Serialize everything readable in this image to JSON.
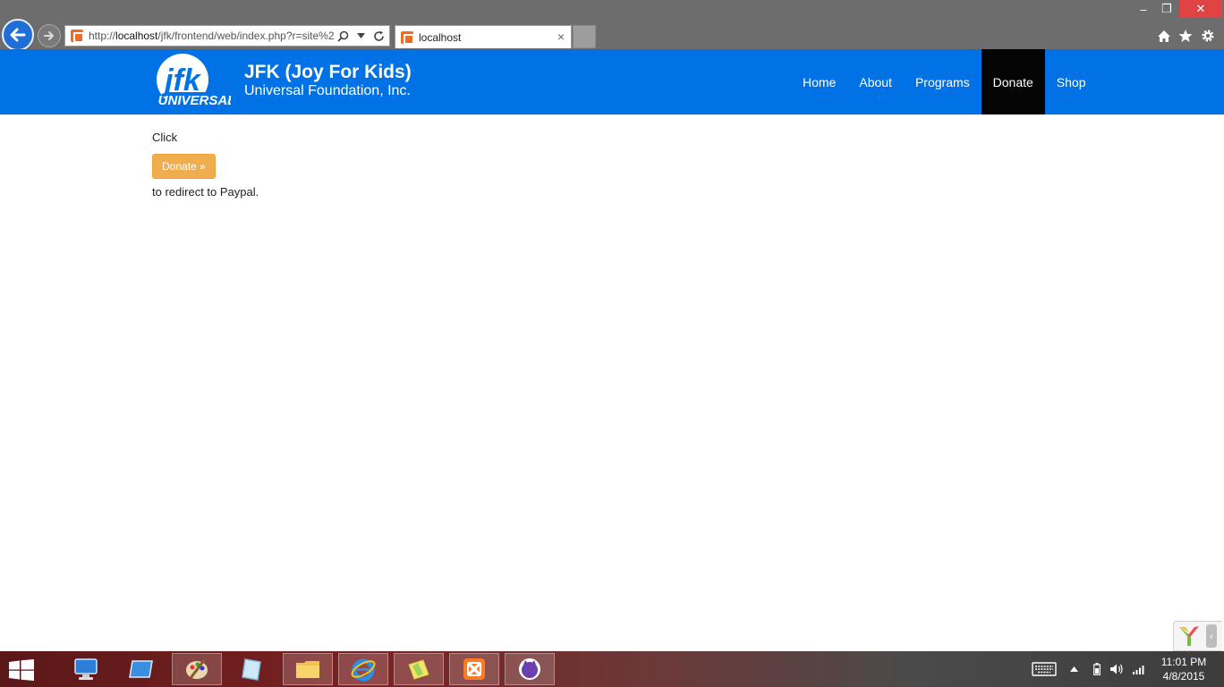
{
  "browser": {
    "url_prefix": "http://",
    "url_host": "localhost",
    "url_path": "/jfk/frontend/web/index.php?r=site%2",
    "tab_title": "localhost",
    "tab_close": "×"
  },
  "window": {
    "minimize": "–",
    "maximize": "❐",
    "close": "✕"
  },
  "header": {
    "brand_title": "JFK (Joy For Kids)",
    "brand_subtitle": "Universal Foundation, Inc.",
    "logo_text": "jfk",
    "logo_subtext": "UNIVERSAL",
    "nav": [
      {
        "label": "Home"
      },
      {
        "label": "About"
      },
      {
        "label": "Programs"
      },
      {
        "label": "Donate"
      },
      {
        "label": "Shop"
      }
    ],
    "active_nav": "Donate"
  },
  "content": {
    "click_text": "Click",
    "donate_button": "Donate »",
    "redirect_text": "to redirect to Paypal."
  },
  "taskbar": {
    "time": "11:01 PM",
    "date": "4/8/2015"
  },
  "colors": {
    "navbar": "#0072e6",
    "active_nav": "#050505",
    "donate_button": "#f0ad4e"
  }
}
